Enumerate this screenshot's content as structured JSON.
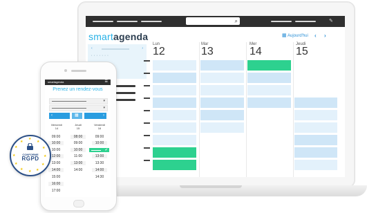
{
  "laptop": {
    "brand_light": "smart",
    "brand_bold": "agenda",
    "today_link": "Aujourd'hui",
    "prev_arrow": "‹",
    "next_arrow": "›",
    "search_icon": "⌕",
    "edit_icon": "✎",
    "days": [
      {
        "name": "Lun",
        "num": "12"
      },
      {
        "name": "Mar",
        "num": "13"
      },
      {
        "name": "Mer",
        "num": "14"
      },
      {
        "name": "Jeudi",
        "num": "15"
      }
    ],
    "colors": {
      "accent": "#27b1e6",
      "brand_dark": "#2c3e50",
      "green": "#2dd18f",
      "light_blue": "#cfe6f7",
      "topbar": "#2f2f2f"
    }
  },
  "phone": {
    "brand": "smartagenda",
    "menu_icon": "☰",
    "title": "Prenez un rendez-vous",
    "nav_prev": "‹",
    "nav_next": "›",
    "nav_grid_icon": "▦",
    "days": [
      {
        "name": "Mercredi",
        "num": "14"
      },
      {
        "name": "Jeudi",
        "num": "15"
      },
      {
        "name": "Vendredi",
        "num": "16"
      }
    ],
    "col1": [
      "09:00",
      "10:00",
      "10:00",
      "12:00",
      "13:00",
      "14:00",
      "15:00",
      "16:00",
      "17:00"
    ],
    "col2": [
      "08:00",
      "09:00",
      "10:00",
      "11:00",
      "13:00",
      "14:00"
    ],
    "col3": [
      "09:00",
      "10:00",
      "",
      "13:00",
      "13:30",
      "14:00",
      "14:30"
    ],
    "selected_check": "✔"
  },
  "badge": {
    "line1": "CONFORME",
    "line2": "RGPD"
  }
}
